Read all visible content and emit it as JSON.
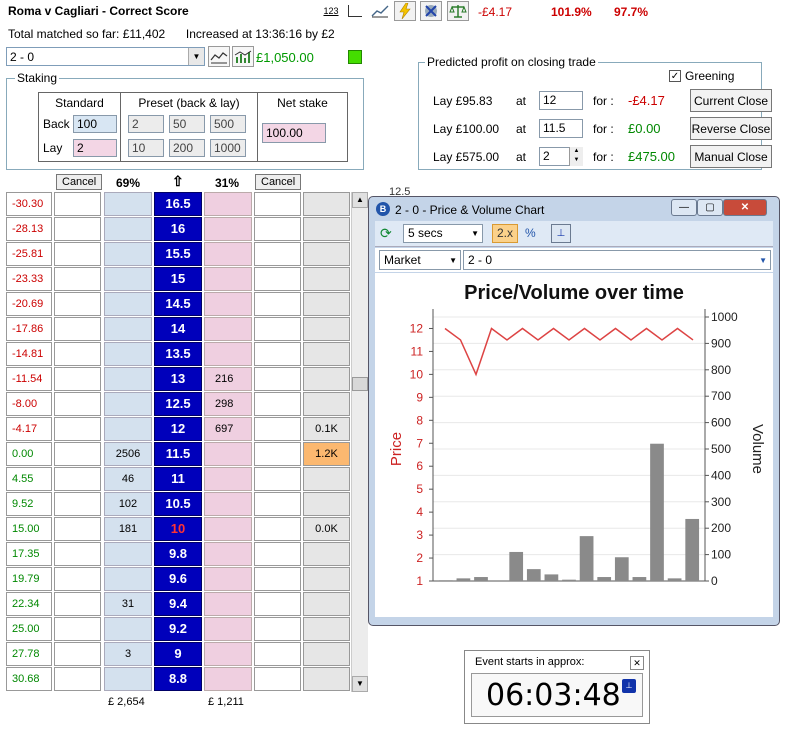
{
  "header": {
    "title": "Roma v Cagliari - Correct Score",
    "icons": [
      "123-icon",
      "blank-icon",
      "chart-icon",
      "lightning-icon",
      "cross-icon",
      "scales-icon"
    ],
    "profit_loss": "-£4.17",
    "back_book": "101.9%",
    "lay_book": "97.7%"
  },
  "info": {
    "matched": "Total matched so far: £11,402",
    "increased": "Increased at 13:36:16 by £2"
  },
  "selection": {
    "value": "2 - 0",
    "liability": "£1,050.00",
    "status_color": "#44dd00"
  },
  "staking": {
    "legend": "Staking",
    "standard_header": "Standard",
    "preset_header": "Preset (back & lay)",
    "net_header": "Net stake",
    "back_label": "Back",
    "lay_label": "Lay",
    "back_value": "100",
    "lay_value": "2",
    "preset_back": [
      "2",
      "50",
      "500"
    ],
    "preset_lay": [
      "10",
      "200",
      "1000"
    ],
    "net_value": "100.00"
  },
  "predicted": {
    "legend": "Predicted profit on closing trade",
    "greening_label": "Greening",
    "greening_checked": "✓",
    "at_label": "at",
    "for_label": "for :",
    "rows": [
      {
        "lay": "Lay  £95.83",
        "odds": "12",
        "result": "-£4.17",
        "button": "Current Close",
        "color": "#cc0000"
      },
      {
        "lay": "Lay  £100.00",
        "odds": "11.5",
        "result": "£0.00",
        "button": "Reverse Close",
        "color": "#008800"
      },
      {
        "lay": "Lay  £575.00",
        "odds": "2",
        "result": "£475.00",
        "button": "Manual Close",
        "color": "#008800"
      }
    ]
  },
  "ladder": {
    "cancel_label": "Cancel",
    "back_pct": "69%",
    "lay_pct": "31%",
    "up_arrow": "⇧",
    "rows": [
      {
        "pl": "-30.30",
        "back": "",
        "price": "16.5",
        "lay": "",
        "vol": ""
      },
      {
        "pl": "-28.13",
        "back": "",
        "price": "16",
        "lay": "",
        "vol": ""
      },
      {
        "pl": "-25.81",
        "back": "",
        "price": "15.5",
        "lay": "",
        "vol": ""
      },
      {
        "pl": "-23.33",
        "back": "",
        "price": "15",
        "lay": "",
        "vol": ""
      },
      {
        "pl": "-20.69",
        "back": "",
        "price": "14.5",
        "lay": "",
        "vol": ""
      },
      {
        "pl": "-17.86",
        "back": "",
        "price": "14",
        "lay": "",
        "vol": ""
      },
      {
        "pl": "-14.81",
        "back": "",
        "price": "13.5",
        "lay": "",
        "vol": ""
      },
      {
        "pl": "-11.54",
        "back": "",
        "price": "13",
        "lay": "216",
        "vol": ""
      },
      {
        "pl": "-8.00",
        "back": "",
        "price": "12.5",
        "lay": "298",
        "vol": ""
      },
      {
        "pl": "-4.17",
        "back": "",
        "price": "12",
        "lay": "697",
        "vol": "0.1K"
      },
      {
        "pl": "0.00",
        "back": "2506",
        "price": "11.5",
        "lay": "",
        "vol": "1.2K"
      },
      {
        "pl": "4.55",
        "back": "46",
        "price": "11",
        "lay": "",
        "vol": ""
      },
      {
        "pl": "9.52",
        "back": "102",
        "price": "10.5",
        "lay": "",
        "vol": ""
      },
      {
        "pl": "15.00",
        "back": "181",
        "price": "10",
        "lay": "",
        "vol": "0.0K"
      },
      {
        "pl": "17.35",
        "back": "",
        "price": "9.8",
        "lay": "",
        "vol": ""
      },
      {
        "pl": "19.79",
        "back": "",
        "price": "9.6",
        "lay": "",
        "vol": ""
      },
      {
        "pl": "22.34",
        "back": "31",
        "price": "9.4",
        "lay": "",
        "vol": ""
      },
      {
        "pl": "25.00",
        "back": "",
        "price": "9.2",
        "lay": "",
        "vol": ""
      },
      {
        "pl": "27.78",
        "back": "3",
        "price": "9",
        "lay": "",
        "vol": ""
      },
      {
        "pl": "30.68",
        "back": "",
        "price": "8.8",
        "lay": "",
        "vol": ""
      }
    ],
    "total_back": "£ 2,654",
    "total_lay": "£ 1,211",
    "last_traded": "10",
    "highlight_vol": "1.2K",
    "hidden_label": "12.5"
  },
  "chart_window": {
    "title": "2 - 0 - Price & Volume Chart",
    "interval": "5 secs",
    "scale_btn": "2.x",
    "pct_btn": "%",
    "market_filter": "Market",
    "selection_filter": "2 - 0"
  },
  "chart_data": {
    "type": "bar",
    "title": "Price/Volume over time",
    "ylabel": "Price",
    "y2label": "Volume",
    "ylim": [
      1,
      12.5
    ],
    "y2lim": [
      0,
      1000
    ],
    "yticks": [
      1,
      2,
      3,
      4,
      5,
      6,
      7,
      8,
      9,
      10,
      11,
      12
    ],
    "y2ticks": [
      0,
      100,
      200,
      300,
      400,
      500,
      600,
      700,
      800,
      900,
      1000
    ],
    "series": [
      {
        "kind": "line",
        "color": "#dd4444",
        "values": [
          12,
          11.5,
          10,
          12,
          11.5,
          12,
          11.5,
          12,
          11.5,
          12,
          11.5,
          12,
          11.5,
          12,
          11.5,
          12,
          11.5
        ]
      },
      {
        "kind": "bar",
        "color": "#8a8a8a",
        "values": [
          3,
          10,
          15,
          0,
          110,
          45,
          25,
          5,
          170,
          15,
          90,
          15,
          520,
          10,
          235
        ]
      }
    ],
    "grid": true
  },
  "countdown": {
    "title": "Event starts in approx:",
    "time": "06:03:48"
  }
}
